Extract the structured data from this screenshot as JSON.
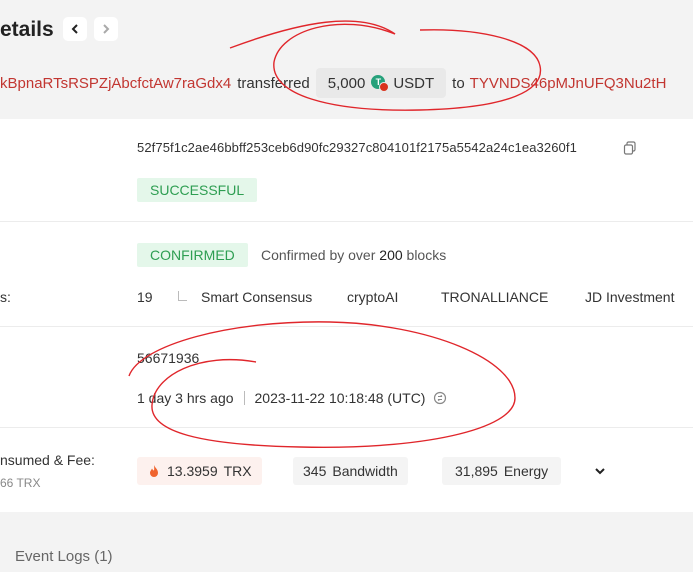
{
  "page": {
    "title": "etails"
  },
  "nav": {
    "prev_icon": "chevron-left-icon",
    "next_icon": "chevron-right-icon"
  },
  "transfer": {
    "from": "kBpnaRTsRSPZjAbcfctAw7raGdx4",
    "verb": "transferred",
    "amount": "5,000",
    "token": "USDT",
    "token_icon_letter": "T",
    "to_word": "to",
    "to": "TYVNDS46pMJnUFQ3Nu2tH"
  },
  "details": {
    "hash": "52f75f1c2ae46bbff253ceb6d90fc29327c804101f2175a5542a24c1ea3260f1",
    "status": "SUCCESSFUL",
    "confirm_badge": "CONFIRMED",
    "confirmed_prefix": "Confirmed by over",
    "confirmed_count": "200",
    "confirmed_suffix": "blocks",
    "sr_label": "s:",
    "sr_count": "19",
    "sr_list": [
      "Smart Consensus",
      "cryptoAI",
      "TRONALLIANCE",
      "JD Investment"
    ],
    "block": "56671936",
    "age": "1 day 3 hrs ago",
    "timestamp": "2023-11-22 10:18:48 (UTC)",
    "resources_label": "nsumed & Fee:",
    "resources_sub": "66 TRX",
    "fee_amount": "13.3959",
    "fee_unit": "TRX",
    "bandwidth_amount": "345",
    "bandwidth_label": "Bandwidth",
    "energy_amount": "31,895",
    "energy_label": "Energy"
  },
  "footer": {
    "event_logs": "Event Logs (1)"
  },
  "colors": {
    "link": "#c23631",
    "success_bg": "#e4f7ea",
    "success_text": "#2e9e52",
    "annotation": "#e0262b"
  }
}
